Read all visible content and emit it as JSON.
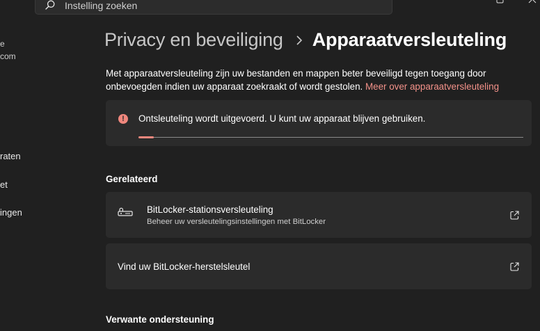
{
  "search": {
    "placeholder": "Instelling zoeken"
  },
  "sidebar": {
    "user_line1": "e",
    "user_line2": "com",
    "items": [
      {
        "label": "raten"
      },
      {
        "label": "et"
      },
      {
        "label": "ingen"
      }
    ]
  },
  "header": {
    "parent": "Privacy en beveiliging",
    "current": "Apparaatversleuteling"
  },
  "description": {
    "text": "Met apparaatversleuteling zijn uw bestanden en mappen beter beveiligd tegen toegang door onbevoegden indien uw apparaat zoekraakt of wordt gestolen.",
    "link": "Meer over apparaatversleuteling"
  },
  "status": {
    "message": "Ontsleuteling wordt uitgevoerd. U kunt uw apparaat blijven gebruiken.",
    "progress": 0.04,
    "accent_color": "#f0877d"
  },
  "related": {
    "heading": "Gerelateerd",
    "items": [
      {
        "title": "BitLocker-stationsversleuteling",
        "subtitle": "Beheer uw versleutelingsinstellingen met BitLocker",
        "icon": "bitlocker-key-icon"
      },
      {
        "title": "Vind uw BitLocker-herstelsleutel"
      }
    ]
  },
  "support": {
    "heading": "Verwante ondersteuning"
  },
  "colors": {
    "background": "#202020",
    "card": "#2b2b2b",
    "link": "#f4928a"
  }
}
